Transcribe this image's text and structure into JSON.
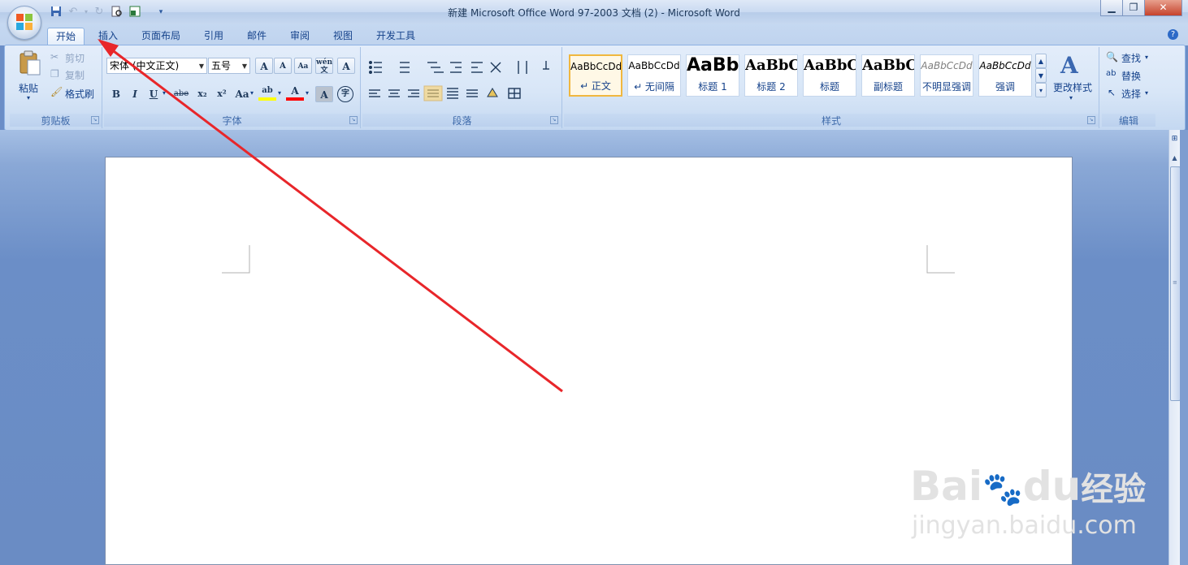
{
  "window": {
    "title": "新建 Microsoft Office Word 97-2003 文档 (2) - Microsoft Word",
    "minimize_glyph": "▁",
    "restore_glyph": "❐",
    "close_glyph": "✕"
  },
  "tabs": [
    {
      "label": "开始"
    },
    {
      "label": "插入"
    },
    {
      "label": "页面布局"
    },
    {
      "label": "引用"
    },
    {
      "label": "邮件"
    },
    {
      "label": "审阅"
    },
    {
      "label": "视图"
    },
    {
      "label": "开发工具"
    }
  ],
  "clipboard": {
    "paste_label": "粘贴",
    "cut_label": "剪切",
    "copy_label": "复制",
    "format_painter_label": "格式刷",
    "group_label": "剪贴板"
  },
  "font": {
    "font_name": "宋体 (中文正文)",
    "font_size": "五号",
    "group_label": "字体",
    "grow_glyph": "A",
    "shrink_glyph": "A",
    "bold": "B",
    "italic": "I",
    "underline": "U",
    "strike": "abe",
    "subscript": "x₂",
    "superscript": "x²",
    "change_case": "Aa",
    "highlight": "ab",
    "font_color": "A",
    "char_shade": "A",
    "enclose": "字",
    "phonetic": "wén",
    "phonetic_char": "文",
    "border_char": "A",
    "clear_glyph": "Aa"
  },
  "paragraph": {
    "group_label": "段落"
  },
  "styles": {
    "group_label": "样式",
    "items": [
      {
        "preview": "AaBbCcDd",
        "label": "↵ 正文"
      },
      {
        "preview": "AaBbCcDd",
        "label": "↵ 无间隔"
      },
      {
        "preview": "AaBb",
        "label": "标题 1"
      },
      {
        "preview": "AaBbC",
        "label": "标题 2"
      },
      {
        "preview": "AaBbC",
        "label": "标题"
      },
      {
        "preview": "AaBbC",
        "label": "副标题"
      },
      {
        "preview": "AaBbCcDd",
        "label": "不明显强调"
      },
      {
        "preview": "AaBbCcDd",
        "label": "强调"
      }
    ],
    "change_styles_label": "更改样式"
  },
  "editing": {
    "find_label": "查找",
    "replace_label": "替换",
    "select_label": "选择",
    "group_label": "编辑"
  },
  "watermark": {
    "brand": "Bai",
    "brand2": "du",
    "brand_cn": "经验",
    "site": "jingyan.baidu.com"
  },
  "colors": {
    "accent": "#15428b",
    "arrow": "#e8262a",
    "highlight": "#ffff00",
    "font_color": "#ff0000"
  }
}
